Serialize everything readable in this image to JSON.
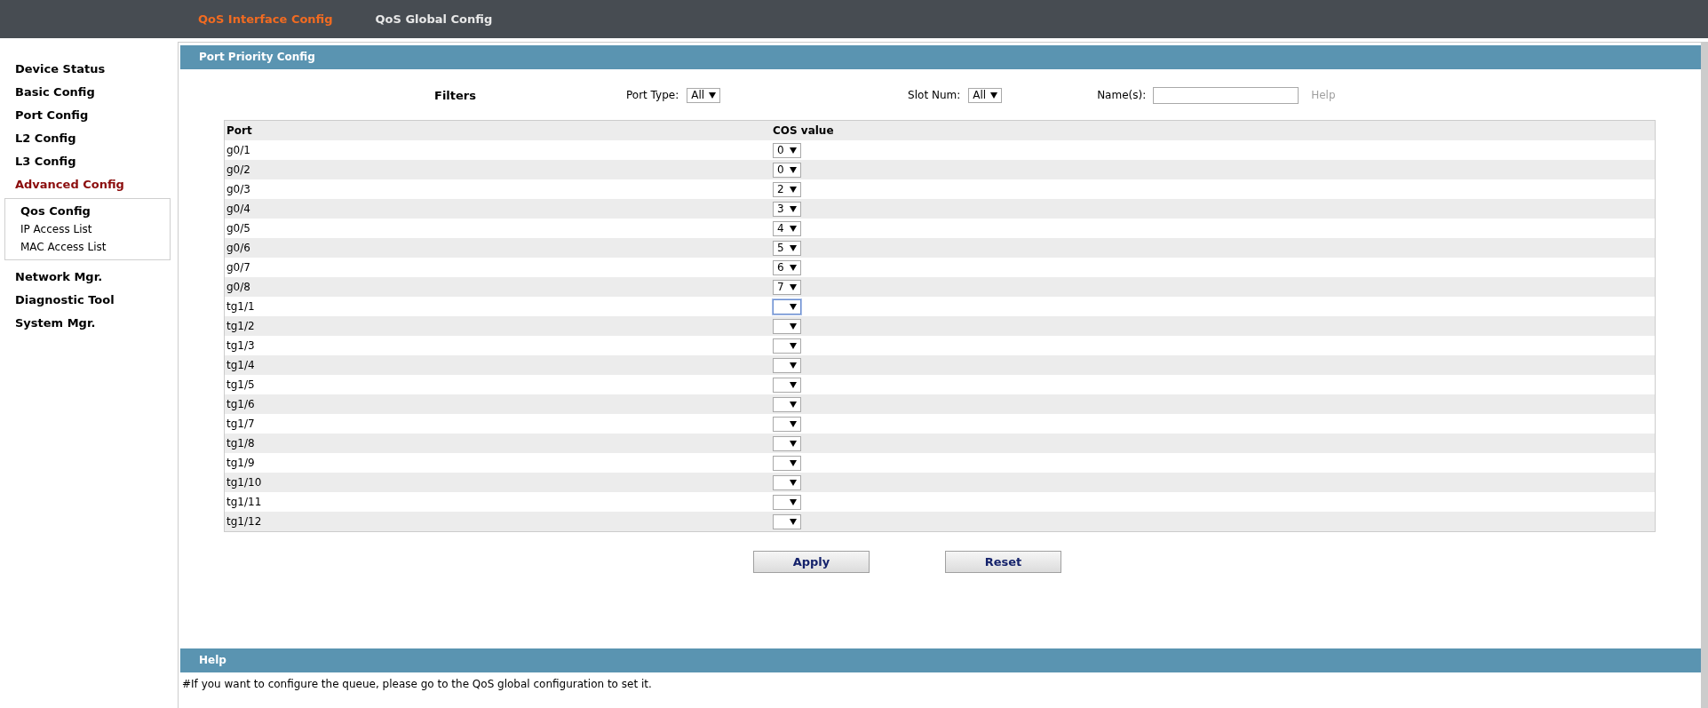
{
  "top_tabs": [
    {
      "label": "QoS Interface Config",
      "selected": true
    },
    {
      "label": "QoS Global Config",
      "selected": false
    }
  ],
  "sidebar": {
    "items": [
      {
        "label": "Device Status",
        "selected": false
      },
      {
        "label": "Basic Config",
        "selected": false
      },
      {
        "label": "Port Config",
        "selected": false
      },
      {
        "label": "L2 Config",
        "selected": false
      },
      {
        "label": "L3 Config",
        "selected": false
      },
      {
        "label": "Advanced Config",
        "selected": true,
        "children": [
          {
            "label": "Qos Config",
            "selected": true
          },
          {
            "label": "IP Access List",
            "selected": false
          },
          {
            "label": "MAC Access List",
            "selected": false
          }
        ]
      },
      {
        "label": "Network Mgr.",
        "selected": false
      },
      {
        "label": "Diagnostic Tool",
        "selected": false
      },
      {
        "label": "System Mgr.",
        "selected": false
      }
    ]
  },
  "panel": {
    "title": "Port Priority Config",
    "filters": {
      "label": "Filters",
      "port_type": {
        "label": "Port Type:",
        "value": "All"
      },
      "slot_num": {
        "label": "Slot Num:",
        "value": "All"
      },
      "names": {
        "label": "Name(s):"
      },
      "help_link": "Help"
    },
    "table": {
      "columns": [
        "Port",
        "COS value"
      ],
      "rows": [
        {
          "port": "g0/1",
          "cos": "0",
          "focused": false
        },
        {
          "port": "g0/2",
          "cos": "0",
          "focused": false
        },
        {
          "port": "g0/3",
          "cos": "2",
          "focused": false
        },
        {
          "port": "g0/4",
          "cos": "3",
          "focused": false
        },
        {
          "port": "g0/5",
          "cos": "4",
          "focused": false
        },
        {
          "port": "g0/6",
          "cos": "5",
          "focused": false
        },
        {
          "port": "g0/7",
          "cos": "6",
          "focused": false
        },
        {
          "port": "g0/8",
          "cos": "7",
          "focused": false
        },
        {
          "port": "tg1/1",
          "focused": true
        },
        {
          "port": "tg1/2",
          "focused": false
        },
        {
          "port": "tg1/3",
          "focused": false
        },
        {
          "port": "tg1/4",
          "focused": false
        },
        {
          "port": "tg1/5",
          "focused": false
        },
        {
          "port": "tg1/6",
          "focused": false
        },
        {
          "port": "tg1/7",
          "focused": false
        },
        {
          "port": "tg1/8",
          "focused": false
        },
        {
          "port": "tg1/9",
          "focused": false
        },
        {
          "port": "tg1/10",
          "focused": false
        },
        {
          "port": "tg1/11",
          "focused": false
        },
        {
          "port": "tg1/12",
          "focused": false
        }
      ]
    },
    "buttons": [
      "Apply",
      "Reset"
    ]
  },
  "help": {
    "title": "Help",
    "text": "#If you want to configure the queue, please go to the QoS global configuration to set it."
  }
}
